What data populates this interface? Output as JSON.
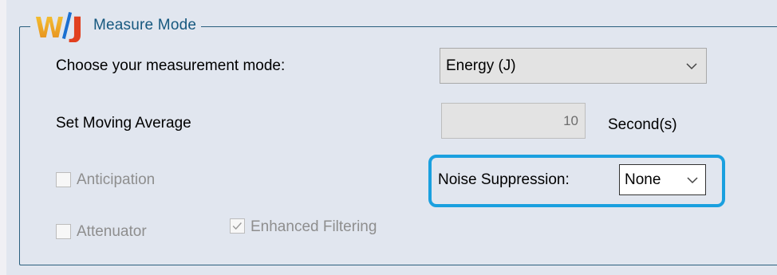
{
  "group": {
    "title": "Measure Mode",
    "logo_text": "W/J"
  },
  "measurement_mode": {
    "label": "Choose your measurement mode:",
    "selected": "Energy (J)"
  },
  "moving_average": {
    "label": "Set Moving Average",
    "value": "10",
    "unit": "Second(s)"
  },
  "anticipation": {
    "label": "Anticipation",
    "checked": false,
    "enabled": false
  },
  "attenuator": {
    "label": "Attenuator",
    "checked": false,
    "enabled": false
  },
  "enhanced_filtering": {
    "label": "Enhanced Filtering",
    "checked": true,
    "enabled": false
  },
  "noise_suppression": {
    "label": "Noise Suppression:",
    "selected": "None"
  },
  "colors": {
    "highlight": "#1aa0df",
    "group_border": "#2a5f7e",
    "legend_text": "#16587f"
  }
}
